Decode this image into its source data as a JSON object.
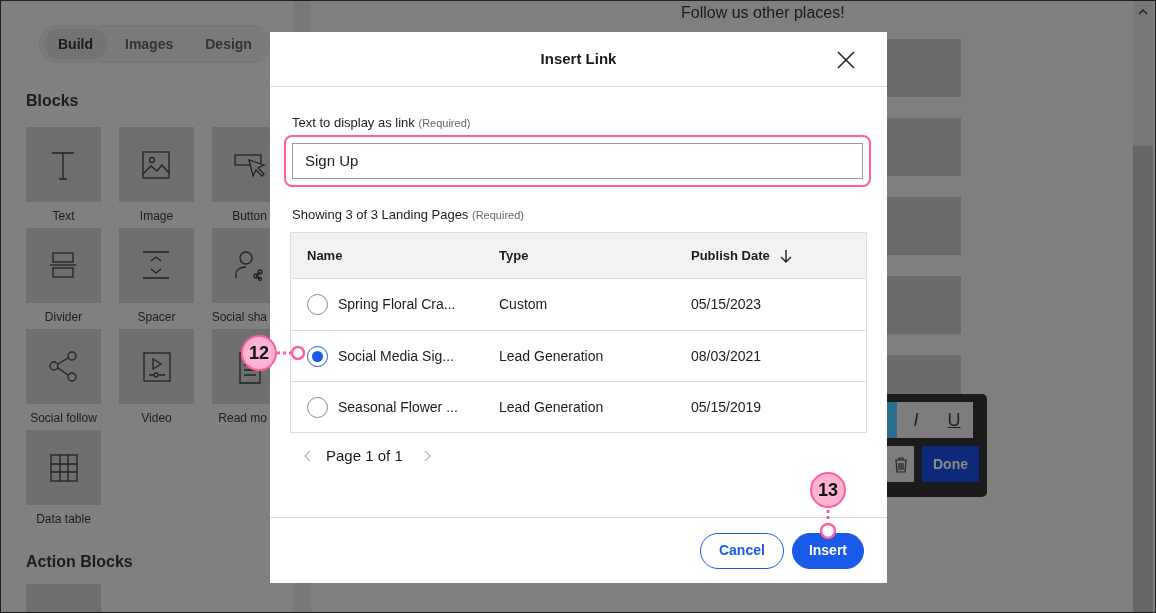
{
  "sidebar": {
    "tabs": [
      {
        "label": "Build",
        "selected": true
      },
      {
        "label": "Images",
        "selected": false
      },
      {
        "label": "Design",
        "selected": false
      }
    ],
    "blocks_heading": "Blocks",
    "blocks": [
      {
        "label": "Text"
      },
      {
        "label": "Image"
      },
      {
        "label": "Button"
      },
      {
        "label": "Divider"
      },
      {
        "label": "Spacer"
      },
      {
        "label": "Social sha"
      },
      {
        "label": "Social follow"
      },
      {
        "label": "Video"
      },
      {
        "label": "Read mo"
      },
      {
        "label": "Data table"
      }
    ],
    "action_heading": "Action Blocks"
  },
  "canvas": {
    "heading": "Follow us other places!"
  },
  "toolbar": {
    "buttons": [
      {
        "kind": "bold",
        "selected": true
      },
      {
        "kind": "italic",
        "label": "I",
        "selected": false
      },
      {
        "kind": "underline",
        "label": "U",
        "selected": false
      }
    ],
    "done": "Done"
  },
  "dialog": {
    "title": "Insert Link",
    "text_field": {
      "label": "Text to display as link",
      "hint": "(Required)",
      "value": "Sign Up"
    },
    "list_label": "Showing 3 of 3 Landing Pages",
    "list_hint": "(Required)",
    "columns": [
      "Name",
      "Type",
      "Publish Date"
    ],
    "rows": [
      {
        "name": "Spring Floral Cra...",
        "type": "Custom",
        "date": "05/15/2023",
        "selected": false
      },
      {
        "name": "Social Media Sig...",
        "type": "Lead Generation",
        "date": "08/03/2021",
        "selected": true
      },
      {
        "name": "Seasonal Flower ...",
        "type": "Lead Generation",
        "date": "05/15/2019",
        "selected": false
      }
    ],
    "pagination": "Page 1 of 1",
    "buttons": [
      {
        "kind": "secondary",
        "label": "Cancel"
      },
      {
        "kind": "primary",
        "label": "Insert"
      }
    ]
  },
  "callouts": [
    {
      "label": "12"
    },
    {
      "label": "13"
    }
  ]
}
